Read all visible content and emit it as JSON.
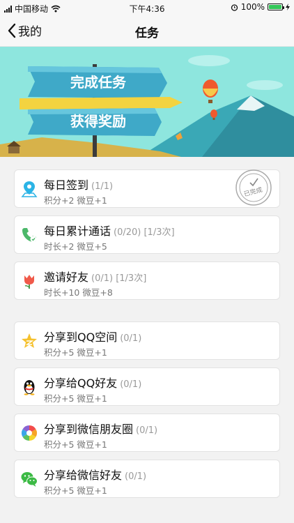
{
  "status_bar": {
    "carrier": "中国移动",
    "time": "下午4:36",
    "battery": "100%"
  },
  "nav": {
    "back_label": "我的",
    "title": "任务"
  },
  "banner": {
    "line1": "完成任务",
    "line2": "获得奖励"
  },
  "tasks_group1": [
    {
      "title": "每日签到",
      "progress": "(1/1)",
      "reward": "积分+2 微豆+1",
      "icon": "location-pin-icon",
      "completed": true,
      "stamp_text": "已完成"
    },
    {
      "title": "每日累计通话",
      "progress": "(0/20) [1/3次]",
      "reward": "时长+2 微豆+5",
      "icon": "phone-icon"
    },
    {
      "title": "邀请好友",
      "progress": "(0/1) [1/3次]",
      "reward": "时长+10 微豆+8",
      "icon": "tulip-icon"
    }
  ],
  "tasks_group2": [
    {
      "title": "分享到QQ空间",
      "progress": "(0/1)",
      "reward": "积分+5 微豆+1",
      "icon": "qzone-star-icon"
    },
    {
      "title": "分享给QQ好友",
      "progress": "(0/1)",
      "reward": "积分+5 微豆+1",
      "icon": "qq-penguin-icon"
    },
    {
      "title": "分享到微信朋友圈",
      "progress": "(0/1)",
      "reward": "积分+5 微豆+1",
      "icon": "wechat-moments-icon"
    },
    {
      "title": "分享给微信好友",
      "progress": "(0/1)",
      "reward": "积分+5 微豆+1",
      "icon": "wechat-icon"
    }
  ]
}
